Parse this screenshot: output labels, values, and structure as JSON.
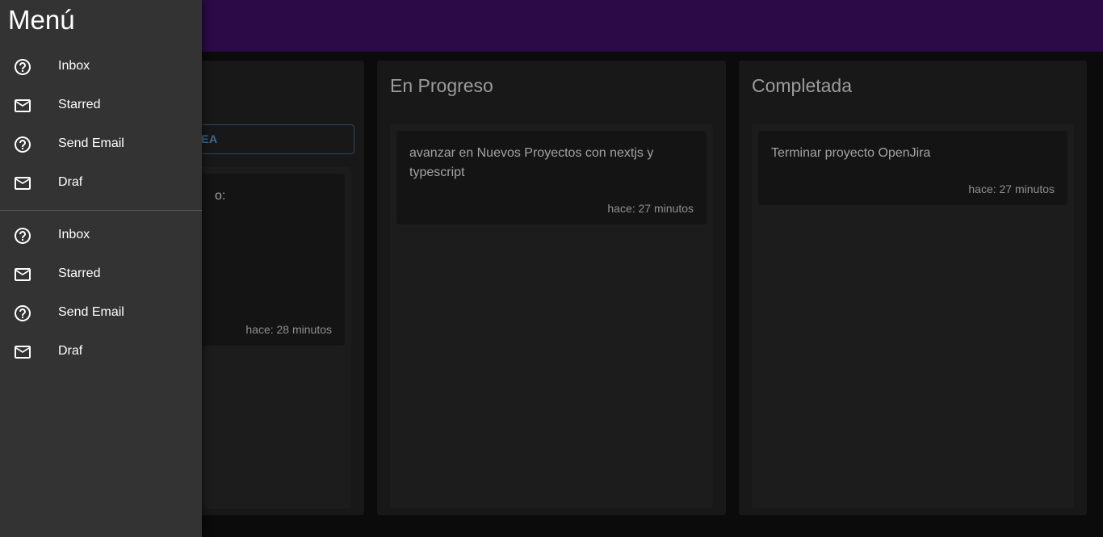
{
  "drawer": {
    "title": "Menú",
    "items": [
      {
        "label": "Inbox",
        "icon": "help-circle-icon"
      },
      {
        "label": "Starred",
        "icon": "mail-icon"
      },
      {
        "label": "Send Email",
        "icon": "help-circle-icon"
      },
      {
        "label": "Draf",
        "icon": "mail-icon"
      },
      {
        "label": "Inbox",
        "icon": "help-circle-icon"
      },
      {
        "label": "Starred",
        "icon": "mail-icon"
      },
      {
        "label": "Send Email",
        "icon": "help-circle-icon"
      },
      {
        "label": "Draf",
        "icon": "mail-icon"
      }
    ]
  },
  "board": {
    "pending": {
      "add_button_label": "R TAREA",
      "cards": [
        {
          "text": "o:",
          "time": "hace: 28 minutos"
        }
      ]
    },
    "in_progress": {
      "title": "En Progreso",
      "cards": [
        {
          "text": "avanzar en Nuevos Proyectos con nextjs y typescript",
          "time": "hace: 27 minutos"
        }
      ]
    },
    "done": {
      "title": "Completada",
      "cards": [
        {
          "text": "Terminar proyecto OpenJira",
          "time": "hace: 27 minutos"
        }
      ]
    }
  },
  "colors": {
    "appbar": "#2b0a47",
    "drawer": "#333333",
    "background": "#0b0b0b"
  }
}
